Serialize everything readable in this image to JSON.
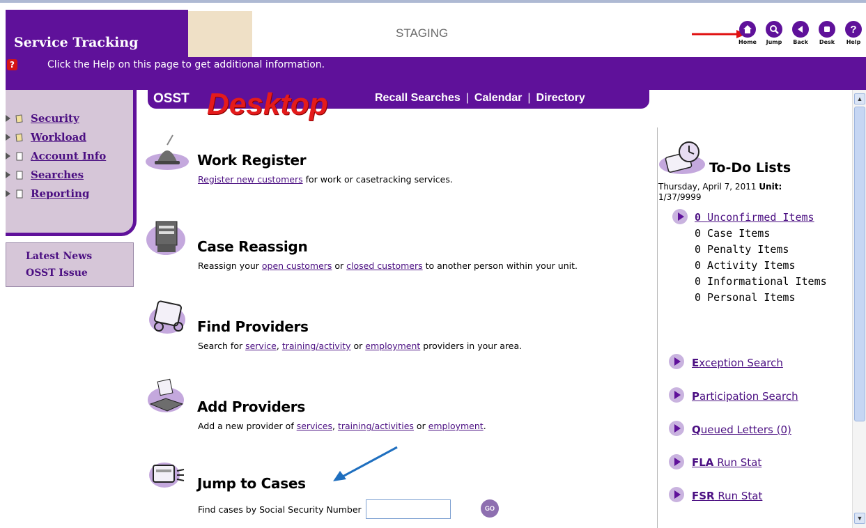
{
  "app": {
    "title": "Service Tracking",
    "environment": "STAGING"
  },
  "topnav": [
    {
      "label": "Home",
      "icon": "home-icon"
    },
    {
      "label": "Jump",
      "icon": "search-icon"
    },
    {
      "label": "Back",
      "icon": "back-icon"
    },
    {
      "label": "Desk",
      "icon": "desk-icon"
    },
    {
      "label": "Help",
      "icon": "help-icon"
    }
  ],
  "helpbar": {
    "text": "Click the Help on this page to get additional information."
  },
  "tabbar": {
    "brand": "OSST",
    "page_name": "Desktop",
    "links": [
      "Recall Searches",
      "Calendar",
      "Directory"
    ],
    "separator": "|"
  },
  "sidebar": {
    "items": [
      {
        "label": "Security",
        "icon": "folder-icon"
      },
      {
        "label": "Workload",
        "icon": "folder-icon"
      },
      {
        "label": "Account Info",
        "icon": "document-icon"
      },
      {
        "label": "Searches",
        "icon": "document-icon"
      },
      {
        "label": "Reporting",
        "icon": "document-icon"
      }
    ]
  },
  "news": {
    "line1": "Latest News",
    "line2": "OSST Issue"
  },
  "sections": {
    "work_register": {
      "title": "Work Register",
      "link1": "Register new customers",
      "text1": " for work or casetracking services."
    },
    "case_reassign": {
      "title": "Case Reassign",
      "text1": "Reassign your ",
      "link1": "open customers",
      "text2": " or ",
      "link2": "closed customers",
      "text3": " to another person within your unit."
    },
    "find_providers": {
      "title": "Find Providers",
      "text1": "Search for ",
      "link1": "service",
      "text2": ", ",
      "link2": "training/activity",
      "text3": " or ",
      "link3": "employment",
      "text4": " providers in your area."
    },
    "add_providers": {
      "title": "Add Providers",
      "text1": "Add a new provider of ",
      "link1": "services",
      "text2": ", ",
      "link2": "training/activities",
      "text3": " or ",
      "link3": "employment",
      "text4": "."
    },
    "jump_to_cases": {
      "title": "Jump to Cases",
      "ssn_label": "Find cases by Social Security Number",
      "ssn_value": "",
      "go_label": "GO"
    }
  },
  "todo": {
    "title": "To-Do Lists",
    "date": "Thursday, April 7, 2011",
    "unit_label": "Unit:",
    "unit_value": "1/37/9999",
    "unconfirmed_count": "0",
    "unconfirmed_label": "Unconfirmed Items",
    "items": [
      "0 Case Items",
      "0 Penalty Items",
      "0 Activity Items",
      "0 Informational Items",
      "0 Personal Items"
    ]
  },
  "right_links": [
    {
      "key": "E",
      "rest": "xception Search"
    },
    {
      "key": "P",
      "rest": "articipation Search"
    },
    {
      "key": "Q",
      "rest": "ueued Letters (0)"
    },
    {
      "key": "FLA",
      "rest": " Run Stat"
    },
    {
      "key": "FSR",
      "rest": " Run Stat"
    }
  ],
  "colors": {
    "brand_purple": "#5f119a",
    "link_purple": "#4b0f82",
    "sidebar_bg": "#d6c6d8",
    "desktop_red": "#e41b1b",
    "annotation_red": "#e01010",
    "annotation_blue": "#1f6fbf"
  }
}
